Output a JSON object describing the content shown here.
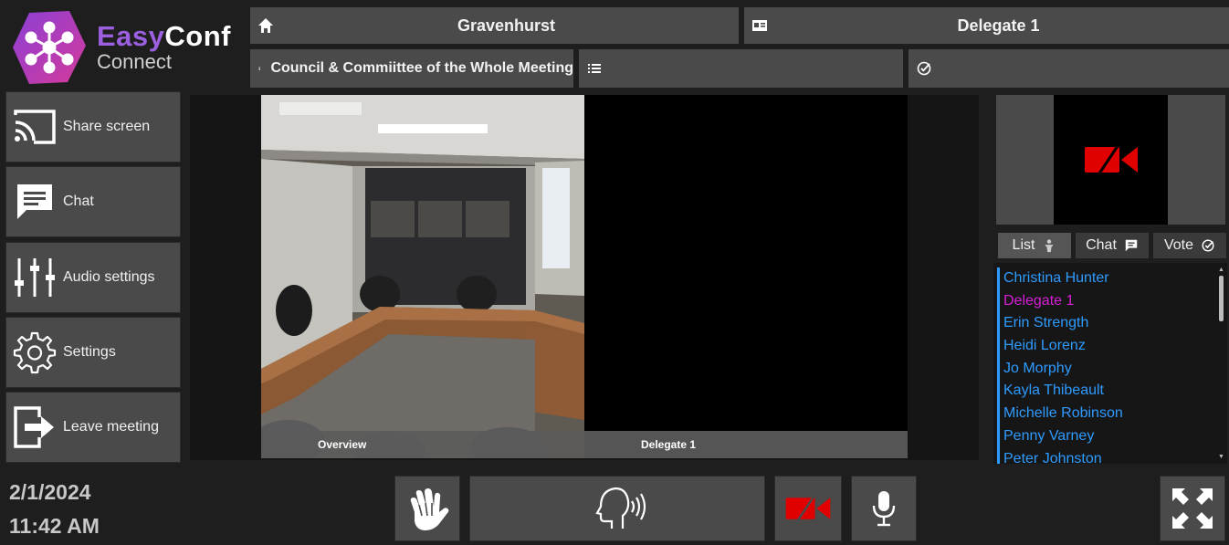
{
  "app": {
    "brand_part1": "Easy",
    "brand_part2": "Conf",
    "brand_sub": "Connect",
    "brand_color": "#9b5fe0"
  },
  "header": {
    "location": "Gravenhurst",
    "user": "Delegate 1",
    "meeting": "Council & Commiittee of the Whole Meeting",
    "agenda": "",
    "vote": ""
  },
  "menu": [
    {
      "icon": "cast-icon",
      "label": "Share screen"
    },
    {
      "icon": "chat-icon",
      "label": "Chat"
    },
    {
      "icon": "sliders-icon",
      "label": "Audio settings"
    },
    {
      "icon": "gear-icon",
      "label": "Settings"
    },
    {
      "icon": "exit-icon",
      "label": "Leave meeting"
    }
  ],
  "video": {
    "tiles": [
      {
        "label": "Overview"
      },
      {
        "label": "Delegate 1"
      }
    ]
  },
  "panel": {
    "tabs": [
      {
        "label": "List",
        "icon": "podium-icon",
        "active": true
      },
      {
        "label": "Chat",
        "icon": "chat-icon"
      },
      {
        "label": "Vote",
        "icon": "check-circle-icon"
      }
    ],
    "participants": [
      {
        "name": "Christina Hunter"
      },
      {
        "name": "Delegate 1",
        "self": true
      },
      {
        "name": "Erin Strength"
      },
      {
        "name": "Heidi Lorenz"
      },
      {
        "name": "Jo Morphy"
      },
      {
        "name": "Kayla Thibeault"
      },
      {
        "name": "Michelle Robinson"
      },
      {
        "name": "Penny Varney"
      },
      {
        "name": "Peter Johnston"
      }
    ],
    "participant_color": "#2e9bff",
    "self_color": "#d61fd6"
  },
  "footer": {
    "date": "2/1/2024",
    "time": "11:42 AM",
    "video_off_color": "#e00000"
  }
}
